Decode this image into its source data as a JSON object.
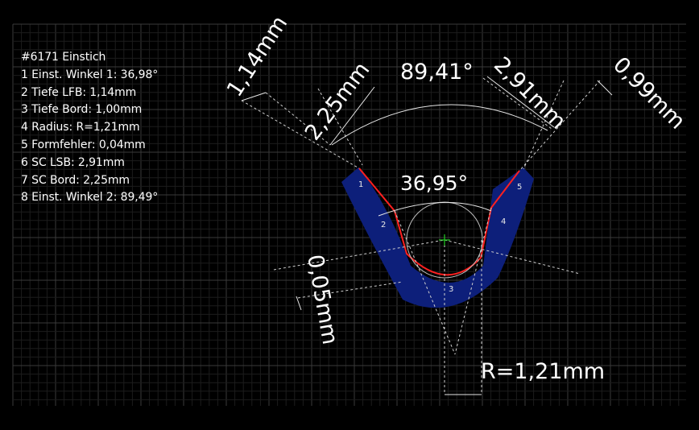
{
  "info": {
    "title": "#6171 Einstich",
    "lines": [
      "1 Einst. Winkel 1: 36,98°",
      "2 Tiefe LFB: 1,14mm",
      "3 Tiefe Bord: 1,00mm",
      "4 Radius: R=1,21mm",
      "5 Formfehler: 0,04mm",
      "6 SC LSB: 2,91mm",
      "7 SC Bord: 2,25mm",
      "8 Einst. Winkel 2: 89,49°"
    ]
  },
  "dimensions": {
    "depth_lfb": "1,14mm",
    "sc_bord": "2,25mm",
    "angle_outer": "89,41°",
    "sc_lsb": "2,91mm",
    "depth_bord": "0,99mm",
    "angle_inner": "36,95°",
    "form_error": "0,05mm",
    "radius": "R=1,21mm"
  },
  "segments": [
    "1",
    "2",
    "3",
    "4",
    "5"
  ],
  "colors": {
    "background": "#000000",
    "grid_minor": "#1c1c1c",
    "grid_major": "#3a3a3a",
    "profile_fill": "#0d1f7a",
    "measured_contour": "#ff1a1a",
    "center_mark": "#22cc22"
  }
}
